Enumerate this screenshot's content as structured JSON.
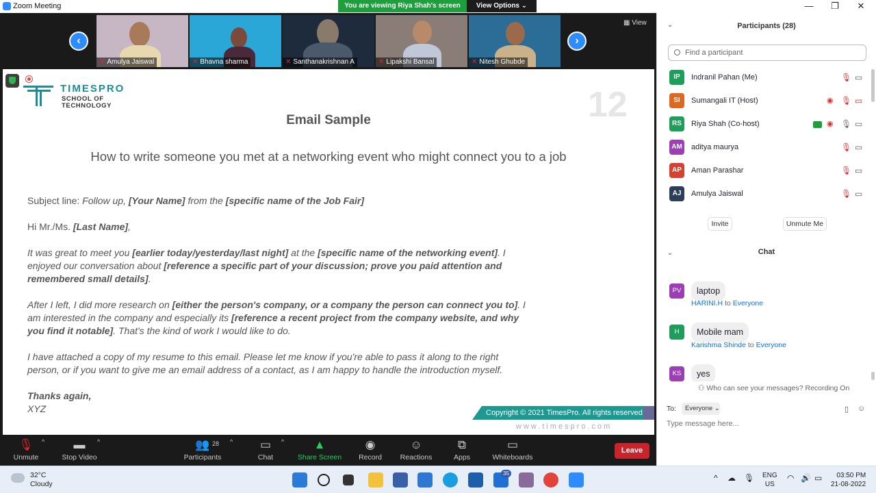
{
  "window": {
    "title": "Zoom Meeting",
    "minimize": "—",
    "restore": "❐",
    "close": "✕"
  },
  "banner": {
    "viewing": "You are viewing Riya Shah's screen",
    "view_options": "View Options ⌄"
  },
  "video_strip": {
    "view_label": "▦ View",
    "tiles": [
      {
        "name": "Amulya Jaiswal"
      },
      {
        "name": "Bhavna sharma"
      },
      {
        "name": "Santhanakrishnan A"
      },
      {
        "name": "Lipakshi Bansal"
      },
      {
        "name": "Nitesh Ghubde"
      }
    ]
  },
  "slide": {
    "logo_line1": "TIMESPRO",
    "logo_line2a": "SCHOOL OF",
    "logo_line2b": "TECHNOLOGY",
    "page_number": "12",
    "title": "Email Sample",
    "subtitle": "How to write someone you met at a networking event who might connect you to a job",
    "subject_prefix": "Subject line: ",
    "subject_italic": "Follow up, ",
    "subject_b1": "[Your Name]",
    "subject_mid": " from the ",
    "subject_b2": "[specific name of the Job Fair]",
    "greeting_plain": "Hi Mr./Ms. ",
    "greeting_bold": "[Last Name]",
    "greeting_end": ",",
    "p1_a": "It was great to meet you ",
    "p1_b": "[earlier today/yesterday/last night]",
    "p1_c": " at the ",
    "p1_d": "[specific name of the networking event]",
    "p1_e": ". I enjoyed our conversation about ",
    "p1_f": "[reference a specific part of your discussion; prove you paid attention and remembered small details]",
    "p1_g": ".",
    "p2_a": "After I left, I did more research on ",
    "p2_b": "[either the person's company, or a company the person can connect you to]",
    "p2_c": ". I am interested in the company and especially its ",
    "p2_d": "[reference a recent project from the company website, and why you find it notable]",
    "p2_e": ". That's the kind of work I would like to do.",
    "p3": "I have attached a copy of my resume to this email. Please let me know if you're able to pass it along to the right person, or if you want to give me an email address of a contact, as I am happy to handle the introduction myself.",
    "closing": "Thanks again,",
    "signature": "XYZ",
    "copyright": "Copyright © 2021 TimesPro. All rights reserved.",
    "website": "www.timespro.com"
  },
  "toolbar": {
    "unmute": "Unmute",
    "stop_video": "Stop Video",
    "participants": "Participants",
    "participants_count": "28",
    "chat": "Chat",
    "share_screen": "Share Screen",
    "record": "Record",
    "reactions": "Reactions",
    "apps": "Apps",
    "whiteboards": "Whiteboards",
    "leave": "Leave"
  },
  "participants_panel": {
    "title": "Participants (28)",
    "search_placeholder": "Find a participant",
    "list": [
      {
        "initials": "IP",
        "name": "Indranil Pahan (Me)",
        "color": "#1e9e5a"
      },
      {
        "initials": "SI",
        "name": "Sumangali IT (Host)",
        "color": "#e0671f"
      },
      {
        "initials": "RS",
        "name": "Riya Shah (Co-host)",
        "color": "#1e9e5a"
      },
      {
        "initials": "AM",
        "name": "aditya maurya",
        "color": "#9c3fb5"
      },
      {
        "initials": "AP",
        "name": "Aman Parashar",
        "color": "#d4432f"
      },
      {
        "initials": "AJ",
        "name": "Amulya Jaiswal",
        "color": "#2c3e5a"
      }
    ],
    "invite": "Invite",
    "unmute_me": "Unmute Me"
  },
  "chat_panel": {
    "title": "Chat",
    "messages": [
      {
        "initials": "PV",
        "color": "#9c3fb5",
        "sender": "",
        "to": "",
        "recipient": "",
        "text": "laptop"
      },
      {
        "initials": "H",
        "color": "#1e9e5a",
        "sender": "HARINI.H",
        "to": " to ",
        "recipient": "Everyone",
        "text": "Mobile mam"
      },
      {
        "initials": "KS",
        "color": "#9c3fb5",
        "sender": "Karishma Shinde",
        "to": " to ",
        "recipient": "Everyone",
        "text": "yes"
      }
    ],
    "who_can_see": "Who can see your messages? Recording On",
    "to_label": "To:",
    "to_value": "Everyone ⌄",
    "input_placeholder": "Type message here..."
  },
  "taskbar": {
    "temperature": "32°C",
    "weather": "Cloudy",
    "mail_badge": "35",
    "lang1": "ENG",
    "lang2": "US",
    "time": "03:50 PM",
    "date": "21-08-2022"
  }
}
